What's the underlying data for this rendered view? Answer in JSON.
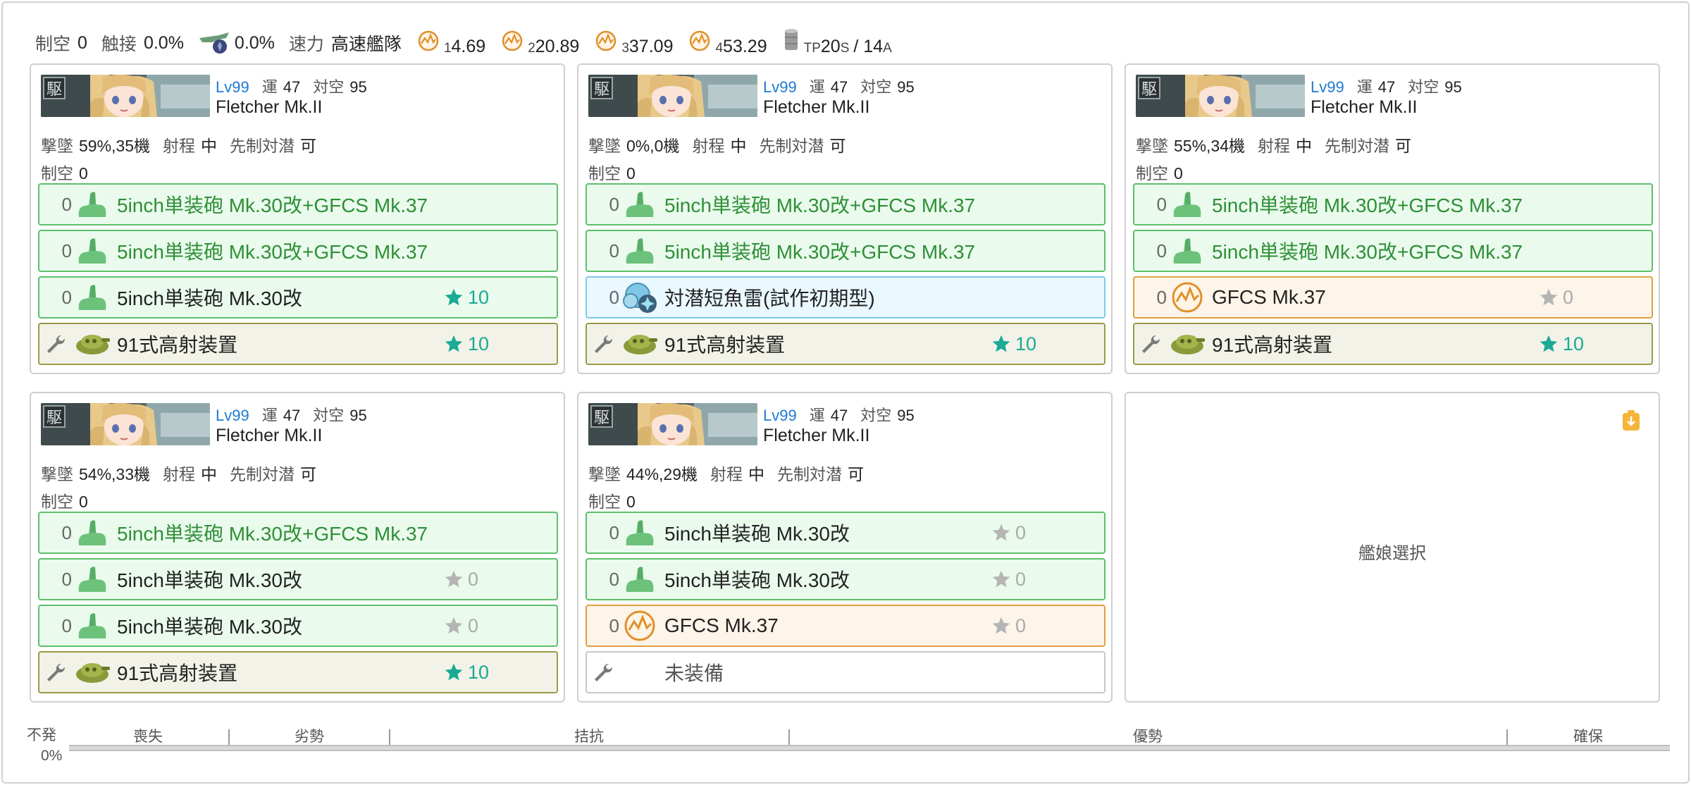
{
  "summary": {
    "seiku_label": "制空",
    "seiku_value": "0",
    "contact_label": "触接",
    "contact_value": "0.0%",
    "recon_value": "0.0%",
    "speed_label": "速力",
    "speed_value": "高速艦隊",
    "los": [
      {
        "sub": "1",
        "value": "4.69"
      },
      {
        "sub": "2",
        "value": "20.89"
      },
      {
        "sub": "3",
        "value": "37.09"
      },
      {
        "sub": "4",
        "value": "53.29"
      }
    ],
    "tp": {
      "label": "TP",
      "s_value": "20",
      "s_sub": "S",
      "sep": "/ 14",
      "a_sub": "A"
    }
  },
  "ships": [
    {
      "lv_label": "Lv",
      "lv": "99",
      "luck_label": "運",
      "luck": "47",
      "aa_label": "対空",
      "aa": "95",
      "name": "Fletcher Mk.II",
      "shootdown_label": "撃墜",
      "shootdown": "59%,35機",
      "range_label": "射程",
      "range": "中",
      "oasw_label": "先制対潜",
      "oasw": "可",
      "air_label": "制空",
      "air": "0",
      "slots": [
        {
          "type": "gun",
          "count": "0",
          "name": "5inch単装砲 Mk.30改+GFCS Mk.37",
          "star": "",
          "highlight": true
        },
        {
          "type": "gun",
          "count": "0",
          "name": "5inch単装砲 Mk.30改+GFCS Mk.37",
          "star": "",
          "highlight": true
        },
        {
          "type": "gun",
          "count": "0",
          "name": "5inch単装砲 Mk.30改",
          "star": "10",
          "highlight": false
        },
        {
          "type": "aa",
          "count": "",
          "name": "91式高射装置",
          "star": "10",
          "highlight": false
        }
      ]
    },
    {
      "lv_label": "Lv",
      "lv": "99",
      "luck_label": "運",
      "luck": "47",
      "aa_label": "対空",
      "aa": "95",
      "name": "Fletcher Mk.II",
      "shootdown_label": "撃墜",
      "shootdown": "0%,0機",
      "range_label": "射程",
      "range": "中",
      "oasw_label": "先制対潜",
      "oasw": "可",
      "air_label": "制空",
      "air": "0",
      "slots": [
        {
          "type": "gun",
          "count": "0",
          "name": "5inch単装砲 Mk.30改+GFCS Mk.37",
          "star": "",
          "highlight": true
        },
        {
          "type": "gun",
          "count": "0",
          "name": "5inch単装砲 Mk.30改+GFCS Mk.37",
          "star": "",
          "highlight": true
        },
        {
          "type": "asw",
          "count": "0",
          "name": "対潜短魚雷(試作初期型)",
          "star": "",
          "highlight": false
        },
        {
          "type": "aa",
          "count": "",
          "name": "91式高射装置",
          "star": "10",
          "highlight": false
        }
      ]
    },
    {
      "lv_label": "Lv",
      "lv": "99",
      "luck_label": "運",
      "luck": "47",
      "aa_label": "対空",
      "aa": "95",
      "name": "Fletcher Mk.II",
      "shootdown_label": "撃墜",
      "shootdown": "55%,34機",
      "range_label": "射程",
      "range": "中",
      "oasw_label": "先制対潜",
      "oasw": "可",
      "air_label": "制空",
      "air": "0",
      "slots": [
        {
          "type": "gun",
          "count": "0",
          "name": "5inch単装砲 Mk.30改+GFCS Mk.37",
          "star": "",
          "highlight": true
        },
        {
          "type": "gun",
          "count": "0",
          "name": "5inch単装砲 Mk.30改+GFCS Mk.37",
          "star": "",
          "highlight": true
        },
        {
          "type": "fcs",
          "count": "0",
          "name": "GFCS Mk.37",
          "star": "0",
          "highlight": false
        },
        {
          "type": "aa",
          "count": "",
          "name": "91式高射装置",
          "star": "10",
          "highlight": false
        }
      ]
    },
    {
      "lv_label": "Lv",
      "lv": "99",
      "luck_label": "運",
      "luck": "47",
      "aa_label": "対空",
      "aa": "95",
      "name": "Fletcher Mk.II",
      "shootdown_label": "撃墜",
      "shootdown": "54%,33機",
      "range_label": "射程",
      "range": "中",
      "oasw_label": "先制対潜",
      "oasw": "可",
      "air_label": "制空",
      "air": "0",
      "slots": [
        {
          "type": "gun",
          "count": "0",
          "name": "5inch単装砲 Mk.30改+GFCS Mk.37",
          "star": "",
          "highlight": true
        },
        {
          "type": "gun",
          "count": "0",
          "name": "5inch単装砲 Mk.30改",
          "star": "0",
          "highlight": false
        },
        {
          "type": "gun",
          "count": "0",
          "name": "5inch単装砲 Mk.30改",
          "star": "0",
          "highlight": false
        },
        {
          "type": "aa",
          "count": "",
          "name": "91式高射装置",
          "star": "10",
          "highlight": false
        }
      ]
    },
    {
      "lv_label": "Lv",
      "lv": "99",
      "luck_label": "運",
      "luck": "47",
      "aa_label": "対空",
      "aa": "95",
      "name": "Fletcher Mk.II",
      "shootdown_label": "撃墜",
      "shootdown": "44%,29機",
      "range_label": "射程",
      "range": "中",
      "oasw_label": "先制対潜",
      "oasw": "可",
      "air_label": "制空",
      "air": "0",
      "slots": [
        {
          "type": "gun",
          "count": "0",
          "name": "5inch単装砲 Mk.30改",
          "star": "0",
          "highlight": false
        },
        {
          "type": "gun",
          "count": "0",
          "name": "5inch単装砲 Mk.30改",
          "star": "0",
          "highlight": false
        },
        {
          "type": "fcs",
          "count": "0",
          "name": "GFCS Mk.37",
          "star": "0",
          "highlight": false
        },
        {
          "type": "empty",
          "count": "",
          "name": "未装備",
          "star": "",
          "highlight": false
        }
      ]
    }
  ],
  "empty_slot": {
    "label": "艦娘選択"
  },
  "air_gauge": {
    "none_label": "不発",
    "percent": "0%",
    "segments": [
      "喪失",
      "劣勢",
      "拮抗",
      "優勢",
      "確保"
    ]
  },
  "colors": {
    "lv_blue": "#1e7ad2",
    "star_on": "#1aaa95",
    "gun_border": "#5cc06a",
    "gun_bg": "#eafbee",
    "asw_border": "#7fc9ea",
    "fcs_border": "#e0a040",
    "aa_border": "#9a9a45"
  },
  "icons": {
    "gun": "small-gun-icon",
    "asw": "asw-torpedo-icon",
    "fcs": "radar-fcs-icon",
    "aa": "aa-director-icon",
    "wrench": "wrench-icon",
    "star": "star-icon"
  }
}
